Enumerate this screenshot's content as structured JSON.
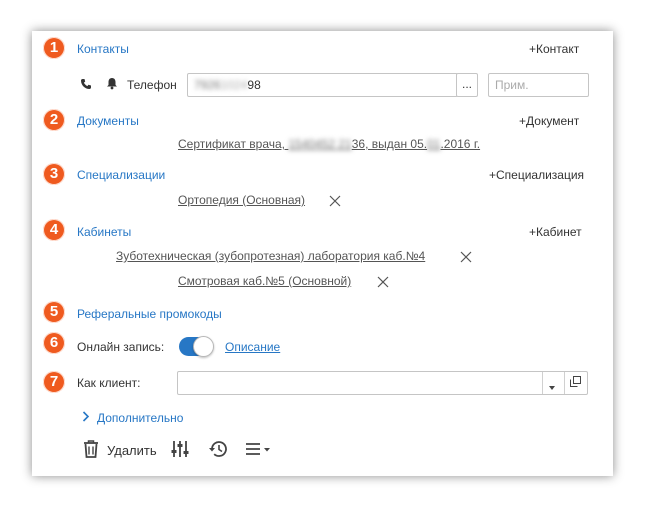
{
  "sections": {
    "contacts": {
      "number": "1",
      "title": "Контакты",
      "add_label": "+Контакт"
    },
    "documents": {
      "number": "2",
      "title": "Документы",
      "add_label": "+Документ"
    },
    "specializations": {
      "number": "3",
      "title": "Специализации",
      "add_label": "+Специализация"
    },
    "cabinets": {
      "number": "4",
      "title": "Кабинеты",
      "add_label": "+Кабинет"
    },
    "promo": {
      "number": "5",
      "title": "Реферальные промокоды"
    },
    "online": {
      "number": "6",
      "label": "Онлайн запись:",
      "toggle_on": true,
      "link": "Описание"
    },
    "client": {
      "number": "7",
      "label": "Как клиент:",
      "value": ""
    }
  },
  "contact_row": {
    "type_label": "Телефон",
    "phone_value_hidden": "7926",
    "phone_value_visible": "98",
    "more_button": "...",
    "note_placeholder": "Прим."
  },
  "documents": {
    "item_prefix": "Сертификат врача, ",
    "item_hidden_1": "1540452 21",
    "item_mid": "36, выдан 05.",
    "item_hidden_2": "01",
    "item_suffix": ".2016 г."
  },
  "specializations": {
    "items": [
      "Ортопедия (Основная)"
    ]
  },
  "cabinets": {
    "items": [
      "Зуботехническая (зубопротезная) лаборатория каб.№4",
      "Смотровая каб.№5 (Основной)"
    ]
  },
  "more_label": "Дополнительно",
  "toolbar": {
    "delete_label": "Удалить"
  },
  "colors": {
    "accent": "#2777c5",
    "badge": "#ef5a1f",
    "toggle": "#2777c5"
  }
}
